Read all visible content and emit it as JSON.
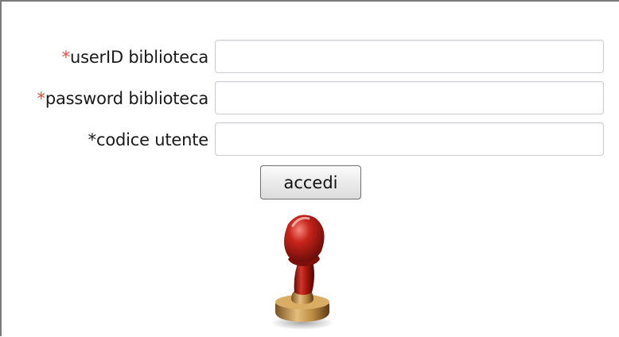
{
  "login_form": {
    "fields": [
      {
        "required_marker": "*",
        "label": "userID biblioteca",
        "value": "",
        "marker_color": "#e24b3c"
      },
      {
        "required_marker": "*",
        "label": "password biblioteca",
        "value": "",
        "marker_color": "#e24b3c"
      },
      {
        "required_marker": "*",
        "label": "codice utente",
        "value": "",
        "marker_color": "#1a1a1a"
      }
    ],
    "submit_label": "accedi"
  },
  "stamp_icon": {
    "icon": "rubber-stamp-icon",
    "handle_color": "#b51a14",
    "base_color": "#c8964a"
  }
}
